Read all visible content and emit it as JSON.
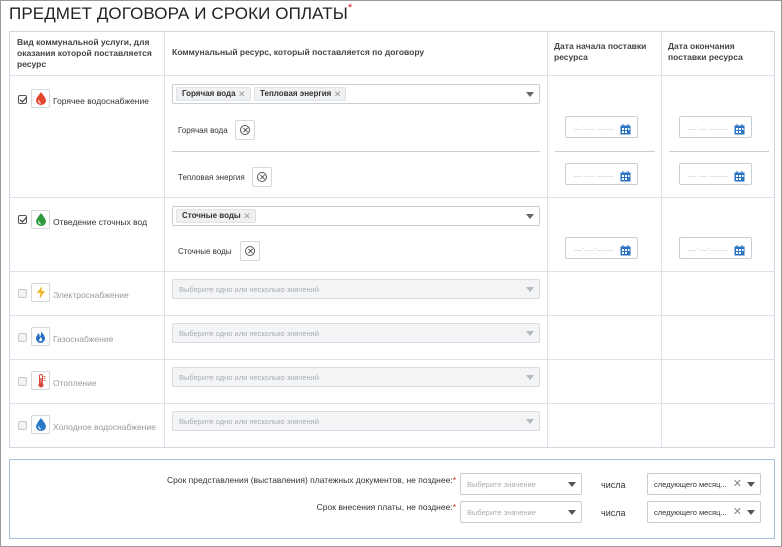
{
  "title": "ПРЕДМЕТ ДОГОВОРА И СРОКИ ОПЛАТЫ",
  "title_required_mark": "*",
  "headers": {
    "service": "Вид коммунальной услуги, для оказания которой поставляется ресурс",
    "resource": "Коммунальный ресурс, который поставляется по договору",
    "start_date": "Дата начала поставки ресурса",
    "end_date": "Дата окончания поставки ресурса"
  },
  "colors": {
    "hot_water": "#e4472b",
    "drainage": "#2f9a3d",
    "electricity": "#f2b526",
    "gas": "#2a6fc7",
    "heating": "#d9473a",
    "cold_water": "#2a79c7",
    "calendar": "#2a73c2"
  },
  "services": [
    {
      "label": "Горячее водоснабжение",
      "icon": "hot-water-drop-icon",
      "checked": true,
      "tags": [
        "Горячая вода",
        "Тепловая энергия"
      ],
      "resources": [
        "Горячая вода",
        "Тепловая энергия"
      ]
    },
    {
      "label": "Отведение сточных вод",
      "icon": "drainage-drop-icon",
      "checked": true,
      "tags": [
        "Сточные воды"
      ],
      "resources": [
        "Сточные воды"
      ]
    },
    {
      "label": "Электроснабжение",
      "icon": "lightning-icon",
      "checked": false,
      "placeholder": "Выберите одно или несколько значений"
    },
    {
      "label": "Газоснабжение",
      "icon": "gas-flame-icon",
      "checked": false,
      "placeholder": "Выберите одно или несколько значений"
    },
    {
      "label": "Отопление",
      "icon": "thermometer-icon",
      "checked": false,
      "placeholder": "Выберите одно или несколько значений"
    },
    {
      "label": "Холодное водоснабжение",
      "icon": "cold-water-drop-icon",
      "checked": false,
      "placeholder": "Выберите одно или несколько значений"
    }
  ],
  "date_mask": "__.__.____",
  "payment": {
    "docs_label": "Срок представления (выставления) платежных документов, не позднее:",
    "pay_label": "Срок внесения платы, не позднее:",
    "required_mark": "*",
    "day_placeholder": "Выберите значение",
    "days_word": "числа",
    "month_value": "следующего месяц...",
    "clear_glyph": "✕"
  }
}
